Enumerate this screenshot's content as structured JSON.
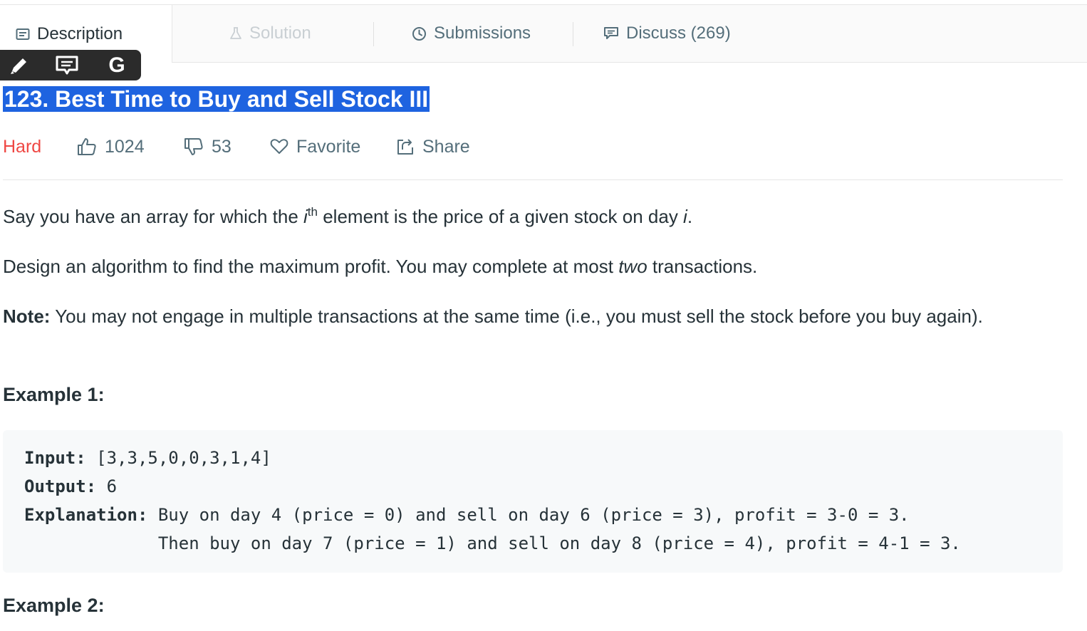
{
  "tabs": {
    "description": "Description",
    "solution": "Solution",
    "submissions": "Submissions",
    "discuss": "Discuss (269)"
  },
  "popup": {
    "g_label": "G"
  },
  "problem": {
    "title": "123. Best Time to Buy and Sell Stock III",
    "difficulty": "Hard",
    "likes": "1024",
    "dislikes": "53",
    "favorite": "Favorite",
    "share": "Share"
  },
  "description": {
    "p1_a": "Say you have an array for which the ",
    "p1_i": "i",
    "p1_sup": "th",
    "p1_b": " element is the price of a given stock on day ",
    "p1_day": "i",
    "p1_end": ".",
    "p2_a": "Design an algorithm to find the maximum profit. You may complete at most ",
    "p2_em": "two",
    "p2_b": " transactions.",
    "note_label": "Note:",
    "note_text": " You may not engage in multiple transactions at the same time (i.e., you must sell the stock before you buy again)."
  },
  "example1": {
    "heading": "Example 1:",
    "input_label": "Input:",
    "input_value": " [3,3,5,0,0,3,1,4]",
    "output_label": "Output:",
    "output_value": " 6",
    "explanation_label": "Explanation:",
    "explanation_1": " Buy on day 4 (price = 0) and sell on day 6 (price = 3), profit = 3-0 = 3.",
    "explanation_2": "             Then buy on day 7 (price = 1) and sell on day 8 (price = 4), profit = 4-1 = 3."
  },
  "example2": {
    "heading": "Example 2:"
  },
  "colors": {
    "accent_selection": "#1e63e0",
    "difficulty_hard": "#ef4743",
    "muted_text": "#546e7a",
    "code_bg": "#f7f9fa"
  },
  "icons": {
    "description": "description-icon",
    "solution": "flask-icon",
    "submissions": "clock-icon",
    "discuss": "comment-icon",
    "like": "thumbs-up-icon",
    "dislike": "thumbs-down-icon",
    "favorite": "heart-icon",
    "share": "share-icon",
    "popup_highlight": "highlighter-icon",
    "popup_comment": "comment-icon",
    "popup_google": "google-icon"
  }
}
